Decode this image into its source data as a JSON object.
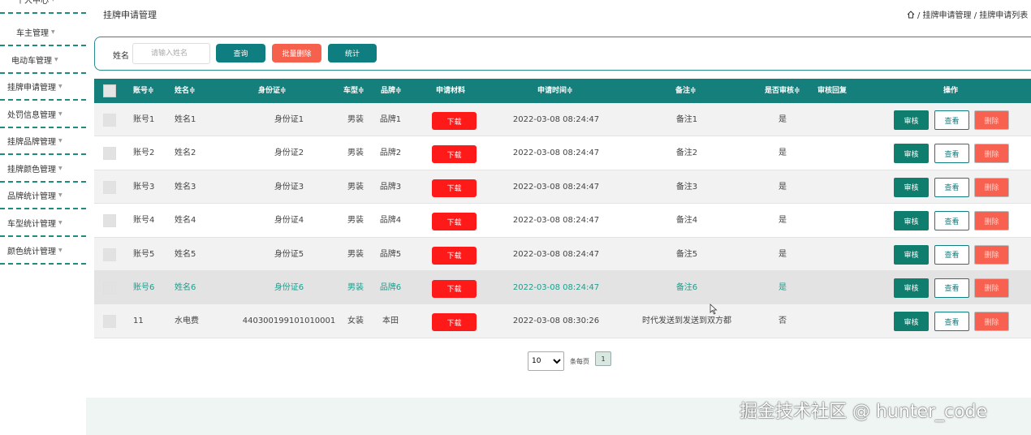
{
  "sidebar": {
    "items": [
      {
        "label": "个人中心"
      },
      {
        "label": "车主管理"
      },
      {
        "label": "电动车管理"
      },
      {
        "label": "挂牌申请管理"
      },
      {
        "label": "处罚信息管理"
      },
      {
        "label": "挂牌品牌管理"
      },
      {
        "label": "挂牌颜色管理"
      },
      {
        "label": "品牌统计管理"
      },
      {
        "label": "车型统计管理"
      },
      {
        "label": "颜色统计管理"
      }
    ],
    "arrow": "▼"
  },
  "header": {
    "title": "挂牌申请管理",
    "breadcrumb": "/ 挂牌申请管理 / 挂牌申请列表"
  },
  "search": {
    "label": "姓名",
    "placeholder": "请输入姓名",
    "query_label": "查询",
    "batch_delete_label": "批量删除",
    "stat_label": "统计"
  },
  "table": {
    "columns": [
      "账号≑",
      "姓名≑",
      "身份证≑",
      "车型≑",
      "品牌≑",
      "申请材料",
      "申请时间≑",
      "备注≑",
      "是否审核≑",
      "审核回复",
      "操作"
    ],
    "download_label": "下载",
    "audit_label": "审核",
    "view_label": "查看",
    "delete_label": "删除",
    "rows": [
      {
        "account": "账号1",
        "name": "姓名1",
        "idcard": "身份证1",
        "type": "男装",
        "brand": "品牌1",
        "time": "2022-03-08 08:24:47",
        "remark": "备注1",
        "audited": "是"
      },
      {
        "account": "账号2",
        "name": "姓名2",
        "idcard": "身份证2",
        "type": "男装",
        "brand": "品牌2",
        "time": "2022-03-08 08:24:47",
        "remark": "备注2",
        "audited": "是"
      },
      {
        "account": "账号3",
        "name": "姓名3",
        "idcard": "身份证3",
        "type": "男装",
        "brand": "品牌3",
        "time": "2022-03-08 08:24:47",
        "remark": "备注3",
        "audited": "是"
      },
      {
        "account": "账号4",
        "name": "姓名4",
        "idcard": "身份证4",
        "type": "男装",
        "brand": "品牌4",
        "time": "2022-03-08 08:24:47",
        "remark": "备注4",
        "audited": "是"
      },
      {
        "account": "账号5",
        "name": "姓名5",
        "idcard": "身份证5",
        "type": "男装",
        "brand": "品牌5",
        "time": "2022-03-08 08:24:47",
        "remark": "备注5",
        "audited": "是"
      },
      {
        "account": "账号6",
        "name": "姓名6",
        "idcard": "身份证6",
        "type": "男装",
        "brand": "品牌6",
        "time": "2022-03-08 08:24:47",
        "remark": "备注6",
        "audited": "是"
      },
      {
        "account": "11",
        "name": "水电费",
        "idcard": "440300199101010001",
        "type": "女装",
        "brand": "本田",
        "time": "2022-03-08 08:30:26",
        "remark": "时代发送到发送到双方都",
        "audited": "否"
      }
    ],
    "highlight_row": 5
  },
  "pagination": {
    "page_size": "10",
    "per_page_label": "条每页",
    "current_page": "1"
  },
  "watermark": "掘金技术社区 @ hunter_code",
  "colors": {
    "primary": "#0f7e80",
    "danger": "#f6614e",
    "download": "#ff1a1a"
  }
}
